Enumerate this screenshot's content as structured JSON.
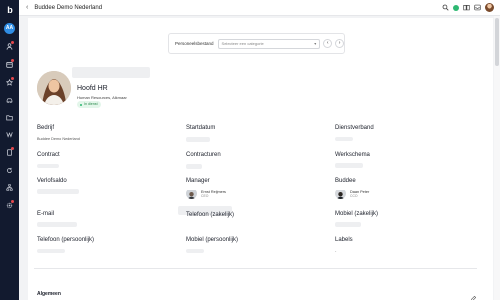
{
  "nav": {
    "logo": "b",
    "me": "AA"
  },
  "topbar": {
    "back": "‹",
    "title": "Buddee Demo Nederland"
  },
  "selector": {
    "label": "Personeelsbestand",
    "placeholder": "Selecteer een categorie",
    "prev": "‹",
    "next": "›"
  },
  "profile": {
    "name": "Hoofd HR",
    "subtitle": "Human Resources, Alkmaar",
    "status": "In dienst"
  },
  "fields": {
    "bedrijf": {
      "label": "Bedrijf",
      "value": "Buddee Demo Nederland"
    },
    "startdatum": {
      "label": "Startdatum"
    },
    "dienstverband": {
      "label": "Dienstverband"
    },
    "contract": {
      "label": "Contract"
    },
    "contracturen": {
      "label": "Contracturen"
    },
    "werkschema": {
      "label": "Werkschema"
    },
    "verlofsaldo": {
      "label": "Verlofsaldo"
    },
    "manager": {
      "label": "Manager",
      "name": "Ernst Reijmers",
      "role": "CEO"
    },
    "buddee": {
      "label": "Buddee",
      "name": "Daan Peter",
      "role": "CCO"
    },
    "email": {
      "label": "E-mail"
    },
    "telefoon_zakelijk": {
      "label": "Telefoon (zakelijk)"
    },
    "mobiel_zakelijk": {
      "label": "Mobiel (zakelijk)"
    },
    "telefoon_persoonlijk": {
      "label": "Telefoon (persoonlijk)"
    },
    "mobiel_persoonlijk": {
      "label": "Mobiel (persoonlijk)"
    },
    "labels": {
      "label": "Labels",
      "value": "-"
    }
  },
  "section": {
    "title": "Algemeen"
  }
}
